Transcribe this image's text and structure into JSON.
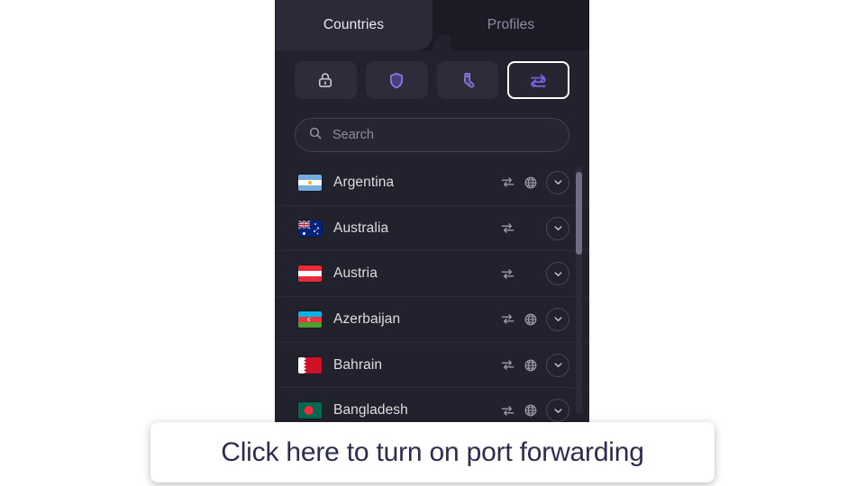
{
  "app": {
    "panel_bg": "#22222e",
    "accent": "#7a63e8",
    "tabs": [
      {
        "label": "Countries",
        "active": true
      },
      {
        "label": "Profiles",
        "active": false
      }
    ],
    "mode_buttons": [
      {
        "name": "openvpn-lock-icon",
        "icon": "lock-icon",
        "label": "",
        "selected": false
      },
      {
        "name": "shield-icon",
        "icon": "shield-icon",
        "label": "",
        "selected": false
      },
      {
        "name": "socks-proxy-icon",
        "icon": "sock-icon",
        "label": "",
        "selected": false
      },
      {
        "name": "port-forwarding-icon",
        "icon": "swap-icon",
        "label": "",
        "selected": true
      }
    ],
    "search": {
      "placeholder": "Search",
      "value": "",
      "icon": "search-icon"
    },
    "list": {
      "chevron_icon": "chevron-down-icon",
      "port_forward_icon": "swap-icon",
      "globe_icon": "globe-icon",
      "countries": [
        {
          "name": "Argentina",
          "flag": "argentina-flag",
          "port_forwarding": true,
          "globe": true
        },
        {
          "name": "Australia",
          "flag": "australia-flag",
          "port_forwarding": true,
          "globe": false
        },
        {
          "name": "Austria",
          "flag": "austria-flag",
          "port_forwarding": true,
          "globe": false
        },
        {
          "name": "Azerbaijan",
          "flag": "azerbaijan-flag",
          "port_forwarding": true,
          "globe": true
        },
        {
          "name": "Bahrain",
          "flag": "bahrain-flag",
          "port_forwarding": true,
          "globe": true
        },
        {
          "name": "Bangladesh",
          "flag": "bangladesh-flag",
          "port_forwarding": true,
          "globe": true
        }
      ]
    },
    "scrollbar": {
      "position": "top"
    }
  },
  "tooltip": {
    "text": "Click here to turn on port forwarding",
    "text_color": "#2b2c4e",
    "bg_color": "#ffffff"
  }
}
